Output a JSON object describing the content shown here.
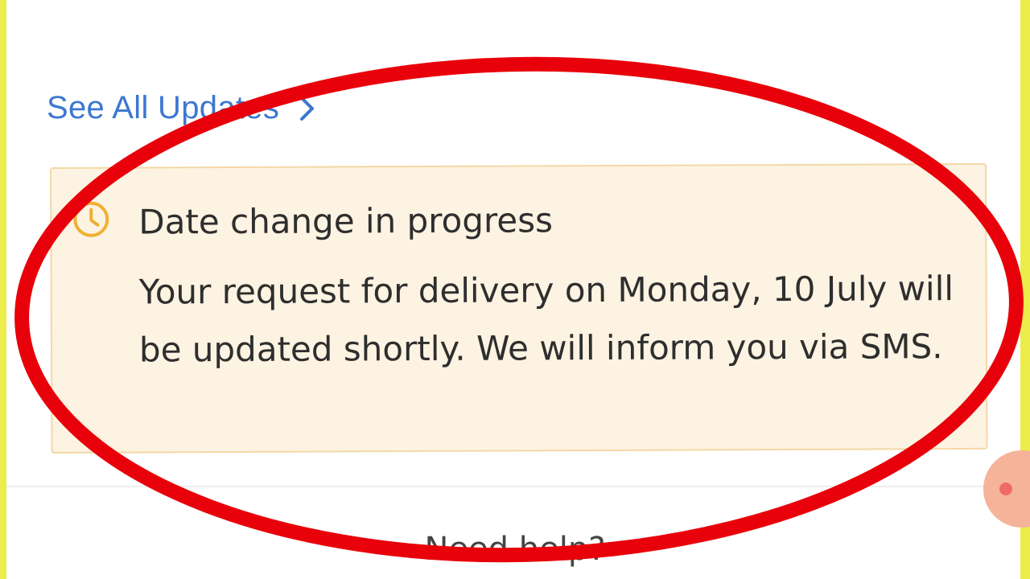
{
  "links": {
    "see_all_updates": "See All Updates"
  },
  "notice": {
    "icon": "clock-icon",
    "title": "Date change in progress",
    "message": "Your request for delivery on Monday, 10 July will be updated shortly. We will inform you via SMS."
  },
  "footer": {
    "need_help": "Need help?"
  },
  "colors": {
    "link": "#3c78d0",
    "notice_bg": "#fdf3e2",
    "notice_border": "#f3d8a6",
    "clock": "#f0b030",
    "annotation": "#e8000a",
    "frame": "#ecec4a"
  }
}
